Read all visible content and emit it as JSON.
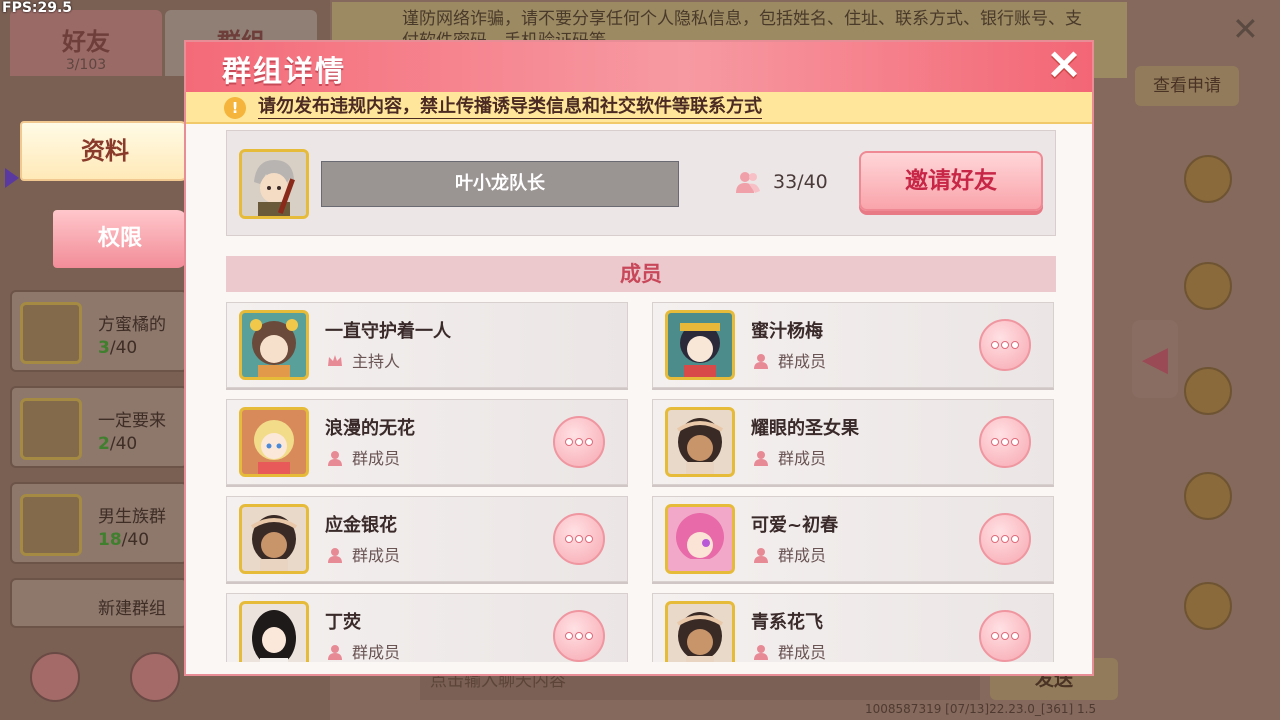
{
  "fps": "FPS:29.5",
  "background": {
    "tabs": [
      {
        "label": "好友",
        "count": "3/103"
      },
      {
        "label": "群组",
        "count": ""
      }
    ],
    "groups": [
      {
        "name": "方蜜橘的",
        "current": "3",
        "total": "/40"
      },
      {
        "name": "一定要来",
        "current": "2",
        "total": "/40"
      },
      {
        "name": "男生族群",
        "current": "18",
        "total": "/40"
      },
      {
        "name": "新建群组",
        "current": "",
        "total": ""
      }
    ],
    "notice": "谨防网络诈骗，请不要分享任何个人隐私信息，包括姓名、住址、联系方式、银行账号、支付软件密码、手机验证码等",
    "apply_label": "查看申请",
    "input_placeholder": "点击输入聊天内容",
    "send_label": "发送",
    "footer": "1008587319   [07/13]22.23.0_[361] 1.5"
  },
  "side_tabs": {
    "profile": "资料",
    "permissions": "权限"
  },
  "modal": {
    "title": "群组详情",
    "close": "×",
    "warning": "请勿发布违规内容，禁止传播诱导类信息和社交软件等联系方式",
    "group_name": "叶小龙队长",
    "member_count": "33/40",
    "invite_label": "邀请好友",
    "members_header": "成员"
  },
  "members": [
    {
      "name": "一直守护着一人",
      "role": "主持人",
      "role_icon": "crown-icon",
      "more": false,
      "avatar_color": "#5aa09a"
    },
    {
      "name": "蜜汁杨梅",
      "role": "群成员",
      "role_icon": "person-icon",
      "more": true,
      "avatar_color": "#4c8c8a"
    },
    {
      "name": "浪漫的无花",
      "role": "群成员",
      "role_icon": "person-icon",
      "more": true,
      "avatar_color": "#d98a5a"
    },
    {
      "name": "耀眼的圣女果",
      "role": "群成员",
      "role_icon": "person-icon",
      "more": true,
      "avatar_color": "#e9d9c9"
    },
    {
      "name": "应金银花",
      "role": "群成员",
      "role_icon": "person-icon",
      "more": true,
      "avatar_color": "#e9d9c9"
    },
    {
      "name": "可爱~初春",
      "role": "群成员",
      "role_icon": "person-icon",
      "more": true,
      "avatar_color": "#f2a9c9"
    },
    {
      "name": "丁荧",
      "role": "群成员",
      "role_icon": "person-icon",
      "more": true,
      "avatar_color": "#ece4dc"
    },
    {
      "name": "青系花飞",
      "role": "群成员",
      "role_icon": "person-icon",
      "more": true,
      "avatar_color": "#e9d9c9"
    }
  ]
}
